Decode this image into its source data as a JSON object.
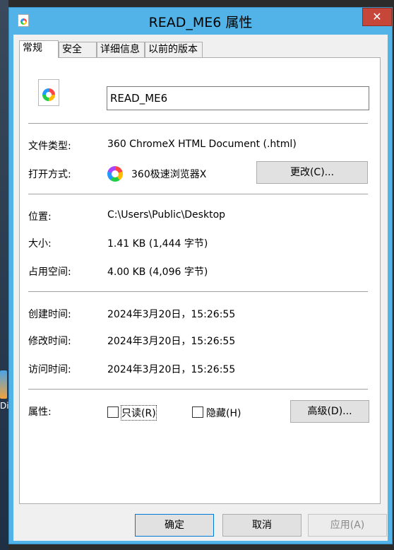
{
  "window": {
    "title": "READ_ME6 属性",
    "close_glyph": "✕"
  },
  "tabs": [
    {
      "label": "常规"
    },
    {
      "label": "安全"
    },
    {
      "label": "详细信息"
    },
    {
      "label": "以前的版本"
    }
  ],
  "general": {
    "file_name": "READ_ME6",
    "file_type_label": "文件类型:",
    "file_type_value": "360 ChromeX HTML Document (.html)",
    "open_with_label": "打开方式:",
    "open_with_value": "360极速浏览器X",
    "change_button": "更改(C)...",
    "location_label": "位置:",
    "location_value": "C:\\Users\\Public\\Desktop",
    "size_label": "大小:",
    "size_value": "1.41 KB (1,444 字节)",
    "size_on_disk_label": "占用空间:",
    "size_on_disk_value": "4.00 KB (4,096 字节)",
    "created_label": "创建时间:",
    "created_value": "2024年3月20日，15:26:55",
    "modified_label": "修改时间:",
    "modified_value": "2024年3月20日，15:26:55",
    "accessed_label": "访问时间:",
    "accessed_value": "2024年3月20日，15:26:55",
    "attributes_label": "属性:",
    "readonly_label": "只读(R)",
    "hidden_label": "隐藏(H)",
    "advanced_button": "高级(D)..."
  },
  "footer": {
    "ok_button": "确定",
    "cancel_button": "取消",
    "apply_button": "应用(A)"
  },
  "desktop": {
    "label_fragment": "Di"
  },
  "colors": {
    "titlebar": "#52b3e8",
    "close": "#c7463a",
    "panel": "#f0f0f0"
  }
}
